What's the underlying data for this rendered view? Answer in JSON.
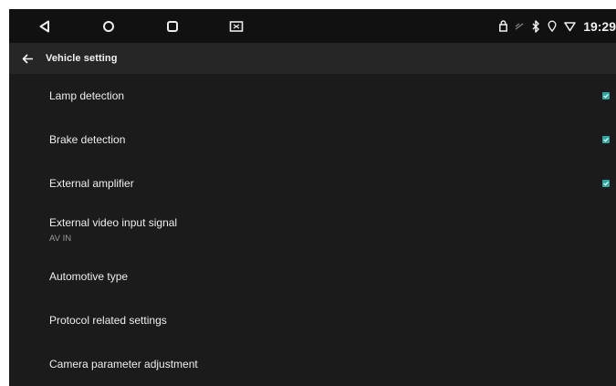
{
  "status_bar": {
    "clock": "19:29",
    "icons": [
      "lock-icon",
      "signal-icon",
      "bluetooth-icon",
      "location-icon",
      "wifi-icon"
    ],
    "nav_icons": [
      "back-triangle-icon",
      "home-circle-icon",
      "recents-square-icon",
      "screenshot-icon"
    ]
  },
  "header": {
    "back_icon": "arrow-left-icon",
    "title": "Vehicle setting"
  },
  "colors": {
    "background": "#1b1b1b",
    "status_bar": "#111111",
    "title_bar": "#262626",
    "checkbox": "#2fa6a6"
  },
  "settings": [
    {
      "label": "Lamp detection",
      "checked": true
    },
    {
      "label": "Brake detection",
      "checked": true
    },
    {
      "label": "External amplifier",
      "checked": true
    },
    {
      "label": "External video input signal",
      "value": "AV IN"
    },
    {
      "label": "Automotive type"
    },
    {
      "label": "Protocol related settings"
    },
    {
      "label": "Camera parameter adjustment"
    }
  ]
}
